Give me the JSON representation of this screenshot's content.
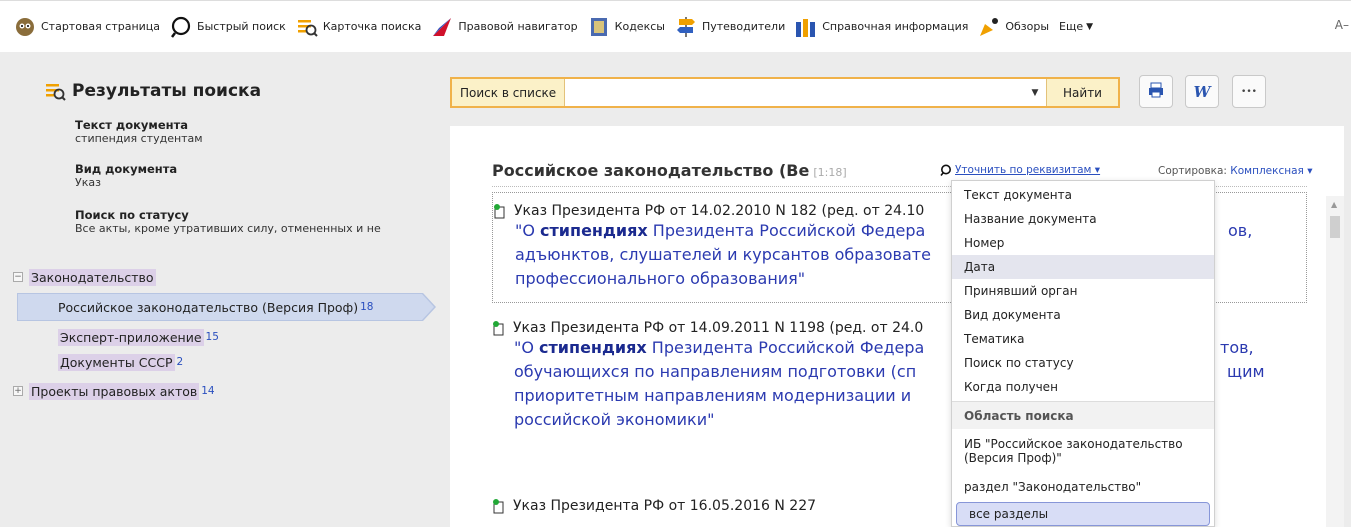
{
  "toolbar": {
    "items": [
      {
        "label": "Стартовая страница",
        "icon": "owl-icon"
      },
      {
        "label": "Быстрый поиск",
        "icon": "search-icon"
      },
      {
        "label": "Карточка поиска",
        "icon": "search-card-icon"
      },
      {
        "label": "Правовой навигатор",
        "icon": "navigator-icon"
      },
      {
        "label": "Кодексы",
        "icon": "codes-icon"
      },
      {
        "label": "Путеводители",
        "icon": "guides-icon"
      },
      {
        "label": "Справочная информация",
        "icon": "reference-icon"
      },
      {
        "label": "Обзоры",
        "icon": "reviews-icon"
      },
      {
        "label": "Еще",
        "icon": "chevron-down-icon"
      }
    ],
    "font_size_label": "А–"
  },
  "left": {
    "title": "Результаты поиска",
    "criteria": [
      {
        "heading": "Текст документа",
        "value": "стипендия студентам"
      },
      {
        "heading": "Вид документа",
        "value": "Указ"
      },
      {
        "heading": "Поиск по статусу",
        "value": "Все акты, кроме утративших силу, отмененных и не"
      }
    ],
    "tree": {
      "group1": {
        "toggle": "−",
        "label": "Законодательство"
      },
      "items": [
        {
          "label": "Российское законодательство (Версия Проф)",
          "count": "18"
        },
        {
          "label": "Эксперт-приложение",
          "count": "15"
        },
        {
          "label": "Документы СССР",
          "count": "2"
        }
      ],
      "group2": {
        "toggle": "+",
        "label": "Проекты правовых актов",
        "count": "14"
      }
    }
  },
  "search": {
    "label": "Поиск в списке",
    "value": "",
    "button": "Найти"
  },
  "actions": {
    "word_label": "W",
    "more_label": "•••"
  },
  "results": {
    "title": "Российское законодательство (Ве",
    "range": "[1:18]",
    "refine": "Уточнить по реквизитам ▾",
    "sort_prefix": "Сортировка:",
    "sort_value": "Комплексная ▾",
    "docs": [
      {
        "head": "Указ Президента РФ от 14.02.2010 N 182 (ред. от 24.10",
        "q1": "\"О ",
        "kw": "стипендиях",
        "lines": [
          " Президента Российской Федера",
          "адъюнктов, слушателей и курсантов образовате",
          "профессионального образования\""
        ],
        "tail": "ов,"
      },
      {
        "head": "Указ Президента РФ от 14.09.2011 N 1198 (ред. от 24.0",
        "q1": "\"О ",
        "kw": "стипендиях",
        "lines": [
          " Президента Российской Федера",
          "обучающихся по направлениям подготовки (сп",
          "приоритетным направлениям модернизации и",
          "российской экономики\""
        ],
        "tail1": "тов,",
        "tail2": "щим"
      },
      {
        "head": "Указ Президента РФ от 16.05.2016 N 227"
      }
    ]
  },
  "menu": {
    "items": [
      "Текст документа",
      "Название документа",
      "Номер",
      "Дата",
      "Принявший орган",
      "Вид документа",
      "Тематика",
      "Поиск по статусу",
      "Когда получен"
    ],
    "section": "Область поиска",
    "scope1_line1": "ИБ \"Российское законодательство",
    "scope1_line2": "(Версия Проф)\"",
    "scope2": "раздел \"Законодательство\"",
    "scope3": "все разделы"
  },
  "colors": {
    "accent_orange": "#f0b24a",
    "link_blue": "#2b3ab0",
    "selected_row": "#cfd9ee",
    "highlight": "#dcd0e8"
  }
}
